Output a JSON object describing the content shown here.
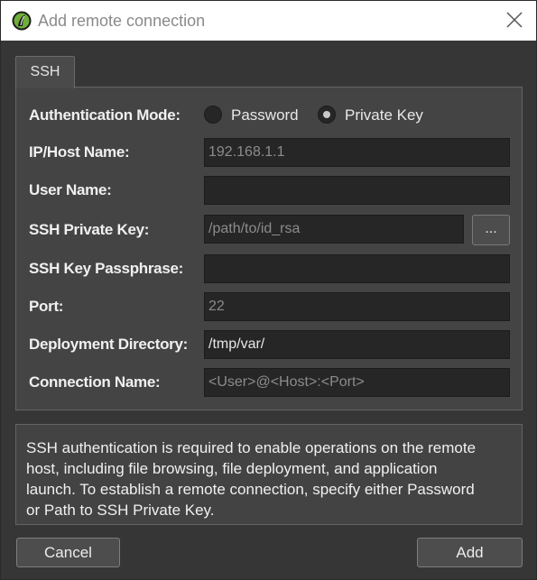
{
  "window": {
    "title": "Add remote connection"
  },
  "tabs": [
    {
      "label": "SSH"
    }
  ],
  "form": {
    "auth_mode": {
      "label": "Authentication Mode:",
      "options": [
        "Password",
        "Private Key"
      ],
      "selected": "Private Key"
    },
    "host": {
      "label": "IP/Host Name:",
      "value": "",
      "placeholder": "192.168.1.1"
    },
    "user": {
      "label": "User Name:",
      "value": "",
      "placeholder": ""
    },
    "private_key": {
      "label": "SSH Private Key:",
      "value": "",
      "placeholder": "/path/to/id_rsa",
      "browse_label": "..."
    },
    "passphrase": {
      "label": "SSH Key Passphrase:",
      "value": "",
      "placeholder": ""
    },
    "port": {
      "label": "Port:",
      "value": "",
      "placeholder": "22"
    },
    "deploy_dir": {
      "label": "Deployment Directory:",
      "value": "/tmp/var/",
      "placeholder": ""
    },
    "conn_name": {
      "label": "Connection Name:",
      "value": "",
      "placeholder": "<User>@<Host>:<Port>"
    }
  },
  "info": {
    "lines": [
      "SSH authentication is required to enable operations on the remote",
      "host, including file browsing, file deployment, and application",
      "launch. To establish a remote connection, specify either Password",
      "or Path to SSH Private Key."
    ]
  },
  "buttons": {
    "cancel": "Cancel",
    "add": "Add"
  },
  "colors": {
    "background": "#363636",
    "panel": "#444444",
    "field": "#262626",
    "titlebar": "#ffffff",
    "app_icon_green": "#6fae3a"
  }
}
